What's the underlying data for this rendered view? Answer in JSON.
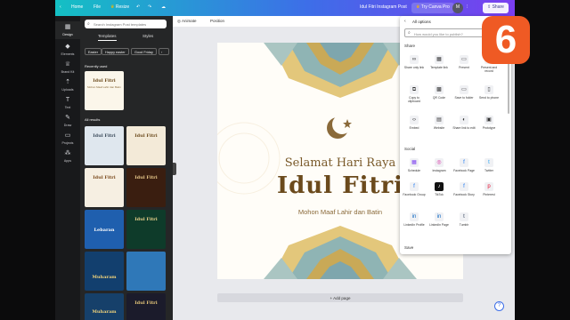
{
  "topbar": {
    "home": "Home",
    "file": "File",
    "resize": "Resize",
    "doc_title": "Idul Fitri Instagram Post",
    "try_pro": "Try Canva Pro",
    "avatar_initial": "M",
    "share": "Share"
  },
  "rail": [
    {
      "label": "Design",
      "icon": "design-icon"
    },
    {
      "label": "Elements",
      "icon": "elements-icon"
    },
    {
      "label": "Brand Kit",
      "icon": "brand-icon"
    },
    {
      "label": "Uploads",
      "icon": "upload-icon"
    },
    {
      "label": "Text",
      "icon": "text-icon"
    },
    {
      "label": "Draw",
      "icon": "draw-icon"
    },
    {
      "label": "Projects",
      "icon": "folder-icon"
    },
    {
      "label": "Apps",
      "icon": "apps-icon"
    }
  ],
  "panel": {
    "search_placeholder": "Search Instagram Post templates",
    "tabs": [
      "Templates",
      "Styles"
    ],
    "chips": [
      "Easter",
      "Happy easter",
      "Good Friday"
    ],
    "recently_used": "Recently used",
    "all_results": "All results",
    "thumbs": [
      {
        "t1": "Idul Fitri",
        "t2": "Mohon Maaf Lahir dan Batin"
      },
      {
        "t1": "Idul Fitri",
        "t2": ""
      },
      {
        "t1": "Idul Fitri",
        "t2": ""
      },
      {
        "t1": "Idul Fitri",
        "t2": ""
      },
      {
        "t1": "Idul Fitri",
        "t2": ""
      },
      {
        "t1": "Lebaran",
        "t2": ""
      },
      {
        "t1": "Idul Fitri",
        "t2": ""
      },
      {
        "t1": "Muharam",
        "t2": ""
      },
      {
        "t1": "",
        "t2": ""
      },
      {
        "t1": "Muharam",
        "t2": ""
      },
      {
        "t1": "Idul Fitri",
        "t2": ""
      }
    ]
  },
  "canvas": {
    "animate": "Animate",
    "position": "Position",
    "greeting_1": "Selamat Hari Raya",
    "greeting_2": "Idul Fitri",
    "greeting_3": "Mohon Maaf Lahir dan Batin",
    "add_page": "+ Add page"
  },
  "share_menu": {
    "back": "‹",
    "title": "All options",
    "search_placeholder": "How would you like to publish?",
    "section_share": "Share",
    "share_options": [
      "Share only link",
      "Template link",
      "Present",
      "Present and record",
      "Copy to clipboard",
      "QR Code",
      "Save to folder",
      "Send to phone",
      "Embed",
      "Website",
      "Share link to edit",
      "Prototype"
    ],
    "section_social": "Social",
    "social_options": [
      "Schedule",
      "Instagram",
      "Facebook Page",
      "Twitter",
      "Facebook Group",
      "TikTok",
      "Facebook Story",
      "Pinterest",
      "LinkedIn Profile",
      "LinkedIn Page",
      "Tumblr"
    ],
    "section_save": "Save"
  },
  "overlay_badge": "6",
  "help": "?",
  "colors": {
    "gradient_start": "#14c0c4",
    "gradient_end": "#7a3ef0",
    "badge": "#ef5a24",
    "gold": "#6b4a1c"
  }
}
